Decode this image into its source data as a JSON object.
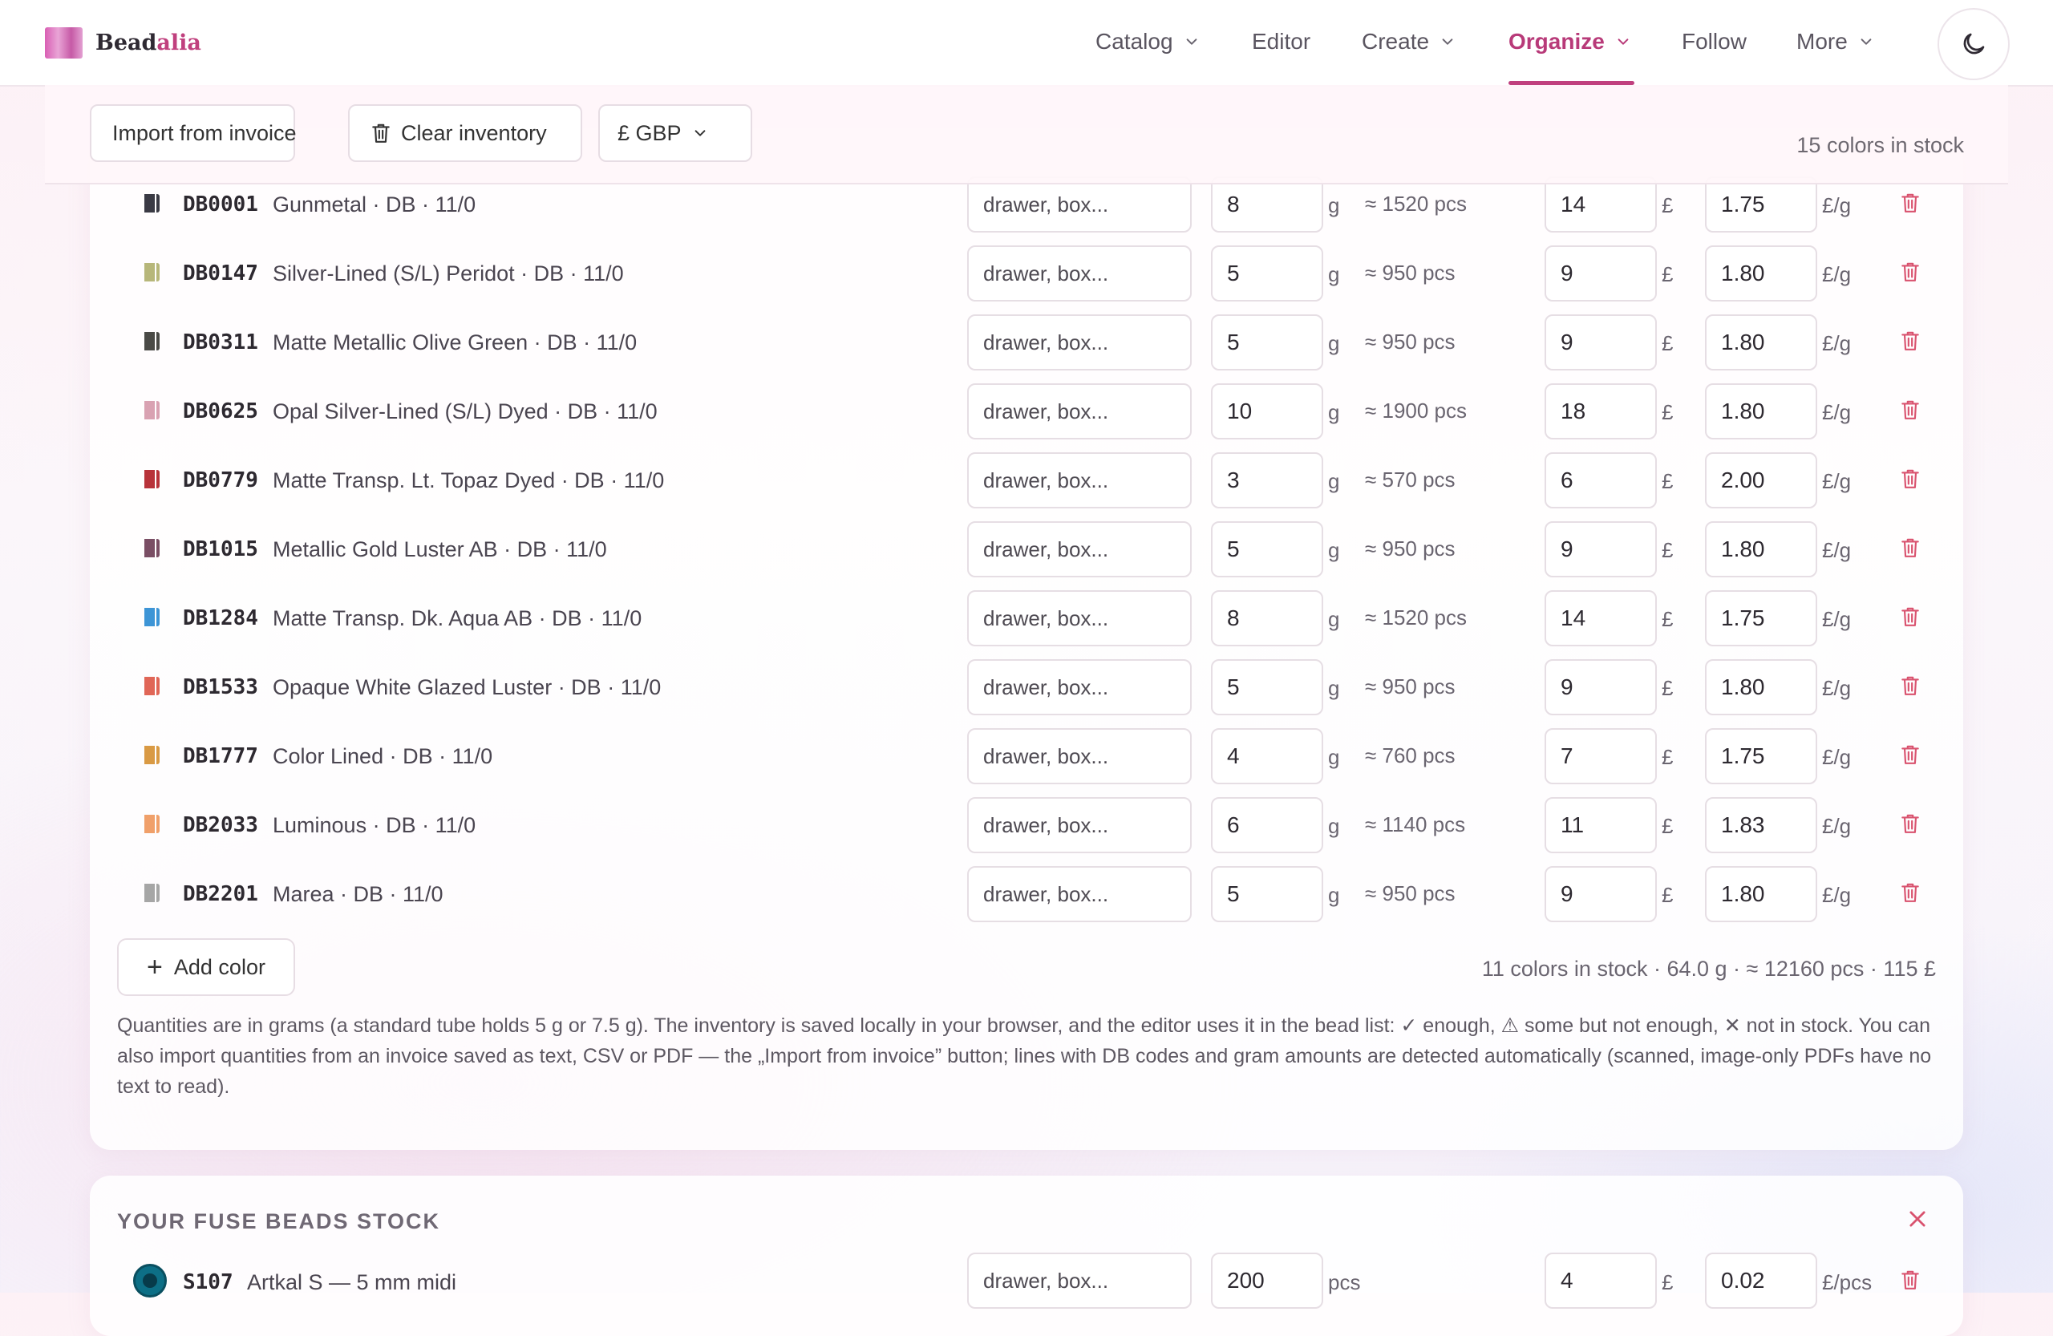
{
  "brand": {
    "name_part1": "Bead",
    "name_part2": "alia"
  },
  "nav": {
    "items": [
      {
        "label": "Catalog",
        "dropdown": true
      },
      {
        "label": "Editor",
        "dropdown": false
      },
      {
        "label": "Create",
        "dropdown": true
      },
      {
        "label": "Organize",
        "dropdown": true,
        "active": true
      },
      {
        "label": "Follow",
        "dropdown": false
      },
      {
        "label": "More",
        "dropdown": true
      }
    ],
    "theme_toggle_icon": "moon-icon"
  },
  "toolbar": {
    "import_label": "Import from invoice",
    "clear_label": "Clear inventory",
    "currency_label": "£ GBP",
    "stock_count": "15 colors in stock"
  },
  "inventory": {
    "location_placeholder": "drawer, box...",
    "gram_unit": "g",
    "currency_symbol": "£",
    "price_unit": "£/g",
    "rows": [
      {
        "code": "DB0001",
        "name": "Gunmetal · DB · 11/0",
        "location": "drawer, box...",
        "grams": "8",
        "pcs": "≈ 1520 pcs",
        "price": "14",
        "per_gram": "1.75",
        "swatch": "#3a3a44"
      },
      {
        "code": "DB0147",
        "name": "Silver-Lined (S/L) Peridot · DB · 11/0",
        "location": "drawer, box...",
        "grams": "5",
        "pcs": "≈ 950 pcs",
        "price": "9",
        "per_gram": "1.80",
        "swatch": "#b7b77a"
      },
      {
        "code": "DB0311",
        "name": "Matte Metallic Olive Green · DB · 11/0",
        "location": "drawer, box...",
        "grams": "5",
        "pcs": "≈ 950 pcs",
        "price": "9",
        "per_gram": "1.80",
        "swatch": "#4a4a46"
      },
      {
        "code": "DB0625",
        "name": "Opal Silver-Lined (S/L) Dyed · DB · 11/0",
        "location": "drawer, box...",
        "grams": "10",
        "pcs": "≈ 1900 pcs",
        "price": "18",
        "per_gram": "1.80",
        "swatch": "#d9a2b2"
      },
      {
        "code": "DB0779",
        "name": "Matte Transp. Lt. Topaz Dyed · DB · 11/0",
        "location": "drawer, box...",
        "grams": "3",
        "pcs": "≈ 570 pcs",
        "price": "6",
        "per_gram": "2.00",
        "swatch": "#b8333a"
      },
      {
        "code": "DB1015",
        "name": "Metallic Gold Luster AB · DB · 11/0",
        "location": "drawer, box...",
        "grams": "5",
        "pcs": "≈ 950 pcs",
        "price": "9",
        "per_gram": "1.80",
        "swatch": "#7a4e64"
      },
      {
        "code": "DB1284",
        "name": "Matte Transp. Dk. Aqua AB · DB · 11/0",
        "location": "drawer, box...",
        "grams": "8",
        "pcs": "≈ 1520 pcs",
        "price": "14",
        "per_gram": "1.75",
        "swatch": "#3d95d6"
      },
      {
        "code": "DB1533",
        "name": "Opaque White Glazed Luster · DB · 11/0",
        "location": "drawer, box...",
        "grams": "5",
        "pcs": "≈ 950 pcs",
        "price": "9",
        "per_gram": "1.80",
        "swatch": "#e06657"
      },
      {
        "code": "DB1777",
        "name": "Color Lined · DB · 11/0",
        "location": "drawer, box...",
        "grams": "4",
        "pcs": "≈ 760 pcs",
        "price": "7",
        "per_gram": "1.75",
        "swatch": "#d99a44"
      },
      {
        "code": "DB2033",
        "name": "Luminous · DB · 11/0",
        "location": "drawer, box...",
        "grams": "6",
        "pcs": "≈ 1140 pcs",
        "price": "11",
        "per_gram": "1.83",
        "swatch": "#f0a06a"
      },
      {
        "code": "DB2201",
        "name": "Marea · DB · 11/0",
        "location": "drawer, box...",
        "grams": "5",
        "pcs": "≈ 950 pcs",
        "price": "9",
        "per_gram": "1.80",
        "swatch": "#a6a6a6"
      }
    ],
    "add_label": "Add color",
    "summary": "11 colors in stock · 64.0 g · ≈ 12160 pcs · 115 £",
    "note": "Quantities are in grams (a standard tube holds 5 g or 7.5 g). The inventory is saved locally in your browser, and the editor uses it in the bead list: ✓ enough, ⚠ some but not enough, ✕ not in stock. You can also import quantities from an invoice saved as text, CSV or PDF — the „Import from invoice” button; lines with DB codes and gram amounts are detected automatically (scanned, image-only PDFs have no text to read)."
  },
  "fuse": {
    "title": "YOUR FUSE BEADS STOCK",
    "row": {
      "code": "S107",
      "name": "Artkal S — 5 mm midi",
      "location": "drawer, box...",
      "qty": "200",
      "qty_unit": "pcs",
      "price": "4",
      "currency": "£",
      "per_unit": "0.02",
      "per_unit_label": "£/pcs",
      "swatch": "#0d6f86"
    }
  },
  "colors": {
    "accent": "#c0407e",
    "trash": "#d9536f"
  }
}
